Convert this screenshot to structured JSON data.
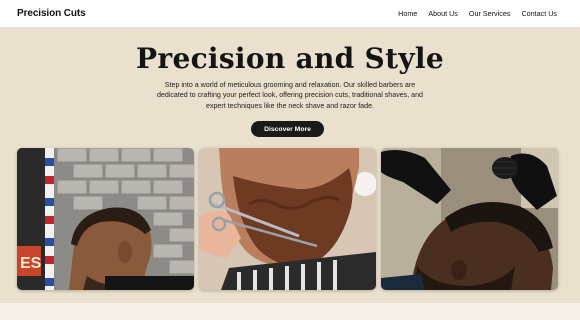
{
  "brand": {
    "name": "Precision Cuts"
  },
  "nav": {
    "items": [
      "Home",
      "About Us",
      "Our Services",
      "Contact Us"
    ]
  },
  "hero": {
    "title": "Precision and Style",
    "description": "Step into a world of meticulous grooming and relaxation. Our skilled barbers are dedicated to crafting your perfect look, offering precision cuts, traditional shaves, and expert techniques like the neck shave and razor fade.",
    "cta_label": "Discover More"
  },
  "gallery": {
    "images": [
      "haircut-side-photo",
      "beard-trim-scissors-photo",
      "beard-shave-gloves-photo"
    ]
  },
  "colors": {
    "hero_bg": "#eae0ce",
    "page_bg": "#f3ece2",
    "button_bg": "#1a1a1a",
    "nav_bg": "#ffffff"
  }
}
